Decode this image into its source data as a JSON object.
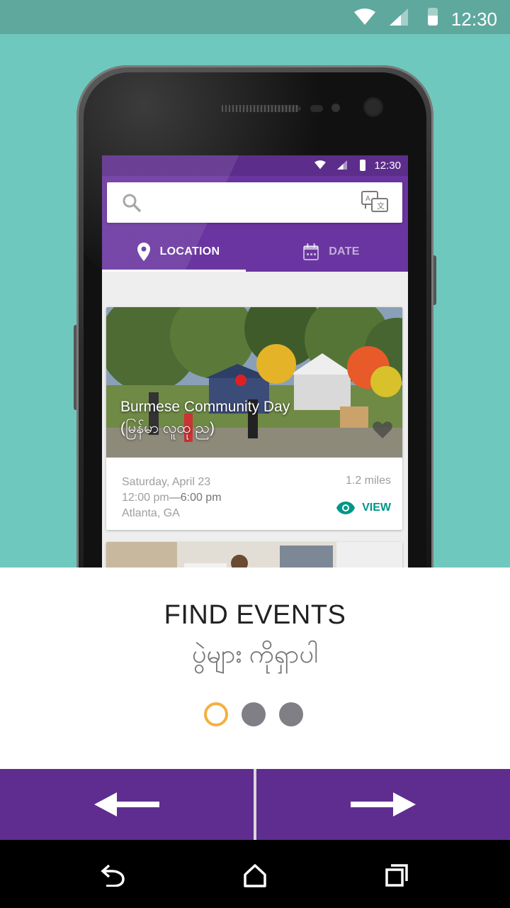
{
  "status_bar": {
    "time": "12:30"
  },
  "preview": {
    "status_time": "12:30",
    "tabs": [
      {
        "label": "LOCATION",
        "icon": "location-pin-icon",
        "active": true
      },
      {
        "label": "DATE",
        "icon": "calendar-icon",
        "active": false
      }
    ],
    "event": {
      "title_line1": "Burmese Community Day",
      "title_line2": "(မြန်မာ လူထု ည)",
      "date": "Saturday, April 23",
      "time_start": "12:00 pm",
      "time_sep": "—",
      "time_end": "6:00 pm",
      "location": "Atlanta, GA",
      "distance": "1.2 miles",
      "view_label": "VIEW"
    }
  },
  "onboarding": {
    "title": "FIND EVENTS",
    "subtitle": "ပွဲများ ကိုရှာပါ",
    "page_count": 3,
    "current_page": 1
  },
  "colors": {
    "teal_background": "#6fc8bd",
    "purple_primary": "#6a35a0",
    "nav_purple": "#5f2d8f",
    "accent_orange": "#f3b040",
    "teal_accent": "#009688"
  }
}
